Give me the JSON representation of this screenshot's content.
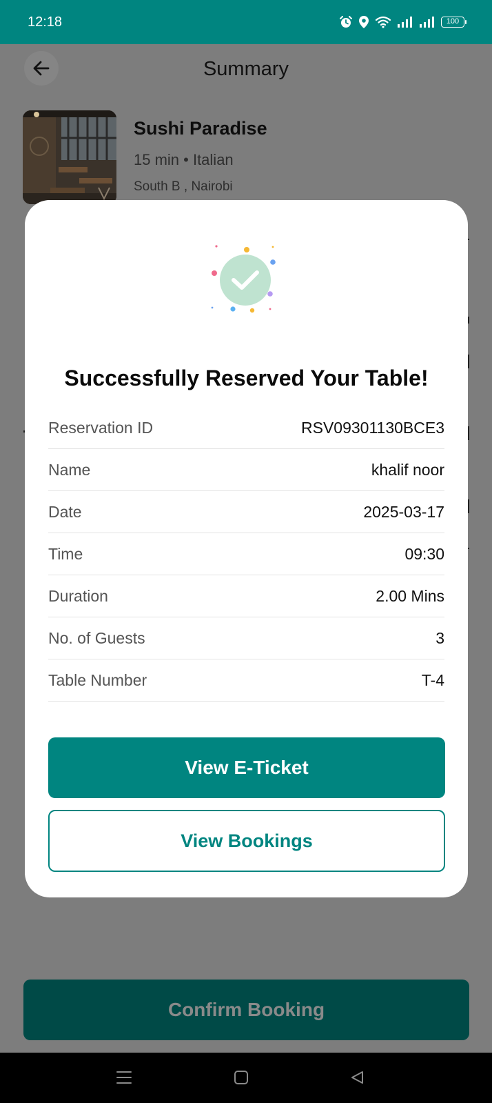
{
  "status_bar": {
    "time": "12:18",
    "battery": "100",
    "icons": [
      "alarm-icon",
      "location-icon",
      "wifi-icon",
      "signal-icon",
      "signal-icon",
      "battery-icon"
    ]
  },
  "header": {
    "title": "Summary",
    "back_icon": "arrow-left-icon"
  },
  "restaurant": {
    "name": "Sushi Paradise",
    "meta": "15 min • Italian",
    "location": "South B , Nairobi"
  },
  "modal": {
    "title": "Successfully Reserved Your Table!",
    "icon": "check-circle-icon",
    "details": [
      {
        "label": "Reservation ID",
        "value": "RSV09301130BCE3"
      },
      {
        "label": "Name",
        "value": "khalif noor"
      },
      {
        "label": "Date",
        "value": "2025-03-17"
      },
      {
        "label": "Time",
        "value": "09:30"
      },
      {
        "label": "Duration",
        "value": "2.00 Mins"
      },
      {
        "label": "No. of Guests",
        "value": "3"
      },
      {
        "label": "Table Number",
        "value": "T-4"
      }
    ],
    "primary_button": "View E-Ticket",
    "secondary_button": "View Bookings"
  },
  "footer": {
    "confirm_button": "Confirm Booking"
  },
  "nav_bar": {
    "icons": [
      "menu-icon",
      "home-icon",
      "back-triangle-icon"
    ]
  },
  "colors": {
    "brand": "#008580",
    "brand_dimmed": "#004a47",
    "overlay": "#7d7d7d",
    "success": "#bfe3d0"
  }
}
